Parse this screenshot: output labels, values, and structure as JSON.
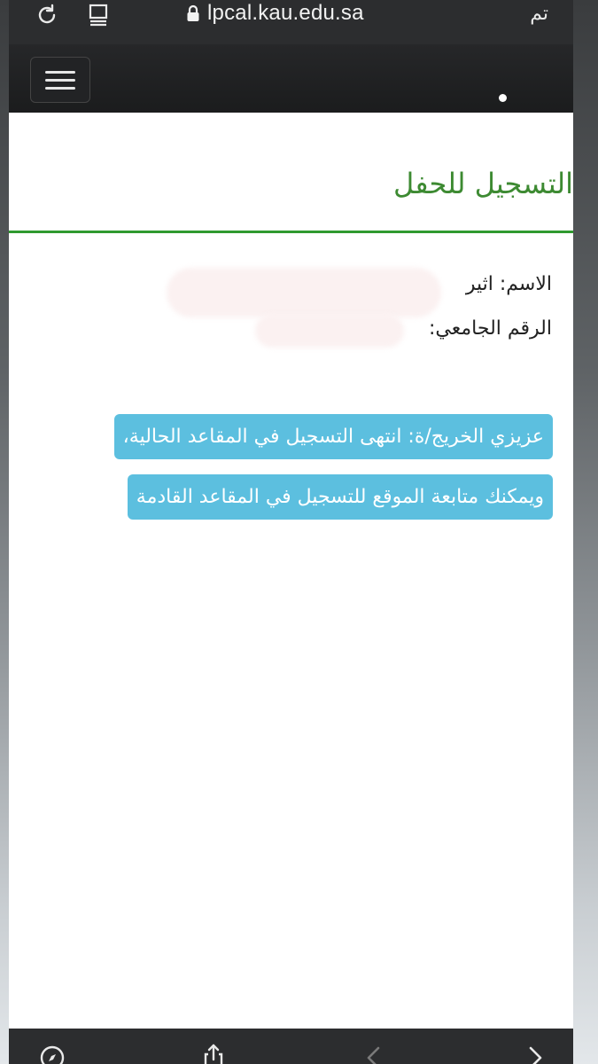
{
  "browser": {
    "url": "lpcal.kau.edu.sa",
    "done_label": "تم",
    "icons": {
      "reload": "reload-icon",
      "reader": "reader-mode-icon",
      "lock": "lock-icon",
      "menu": "hamburger-menu-icon",
      "compass": "compass-icon",
      "share": "share-icon",
      "back": "chevron-left-icon",
      "forward": "chevron-right-icon"
    }
  },
  "page": {
    "title": "التسجيل للحفل",
    "name_line": "الاسم: اثير",
    "id_line": "الرقم الجامعي:",
    "notice": "عزيزي الخريج/ة: انتهى التسجيل في المقاعد الحالية، ويمكنك متابعة الموقع للتسجيل في المقاعد القادمة"
  },
  "colors": {
    "title_green": "#3d8a32",
    "rule_green": "#2f9a2f",
    "notice_bg": "#5cbfdf",
    "header_dark": "#1b1c1d"
  }
}
